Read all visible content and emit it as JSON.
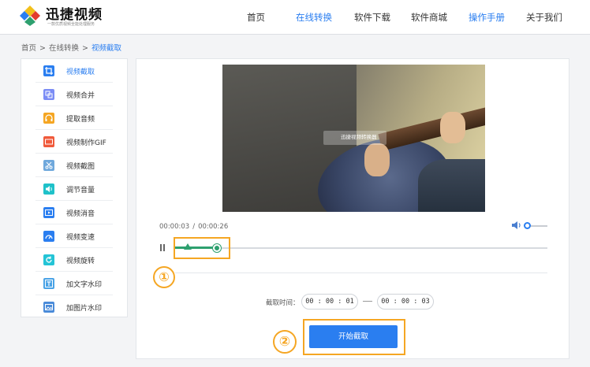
{
  "header": {
    "logo_title": "迅捷视频",
    "logo_subtitle": "一款优质视频全能处理服务",
    "nav": [
      {
        "label": "首页",
        "active": false
      },
      {
        "label": "在线转换",
        "active": true
      },
      {
        "label": "软件下载",
        "active": false
      },
      {
        "label": "软件商城",
        "active": false
      },
      {
        "label": "操作手册",
        "active": true
      },
      {
        "label": "关于我们",
        "active": false
      }
    ]
  },
  "breadcrumb": {
    "items": [
      "首页",
      "在线转换"
    ],
    "current": "视频截取",
    "separator": ">"
  },
  "sidebar": {
    "items": [
      {
        "label": "视频截取",
        "icon": "crop-icon",
        "color": "#2a7ef0",
        "active": true
      },
      {
        "label": "视频合并",
        "icon": "merge-icon",
        "color": "#7b8cf5"
      },
      {
        "label": "提取音频",
        "icon": "headphone-icon",
        "color": "#f5a623"
      },
      {
        "label": "视频制作GIF",
        "icon": "gif-icon",
        "color": "#f05a3b"
      },
      {
        "label": "视频截图",
        "icon": "scissors-icon",
        "color": "#6fa8dc"
      },
      {
        "label": "调节音量",
        "icon": "volume-icon",
        "color": "#1fc1c9"
      },
      {
        "label": "视频消音",
        "icon": "mute-icon",
        "color": "#2a7ef0"
      },
      {
        "label": "视频变速",
        "icon": "speed-icon",
        "color": "#2a7ef0"
      },
      {
        "label": "视频旋转",
        "icon": "rotate-icon",
        "color": "#24c4d6"
      },
      {
        "label": "加文字水印",
        "icon": "text-watermark-icon",
        "color": "#4aa3e6"
      },
      {
        "label": "加图片水印",
        "icon": "image-watermark-icon",
        "color": "#4a8bd9"
      }
    ]
  },
  "player": {
    "watermark": "迅捷视频转换器",
    "current_time": "00:00:03",
    "total_time": "00:00:26",
    "time_separator": "/",
    "volume": 0.1
  },
  "cut": {
    "label": "截取时间：",
    "start": "00 : 00 : 01",
    "end": "00 : 00 : 03",
    "button": "开始截取"
  },
  "annotations": {
    "step1": "①",
    "step2": "②",
    "highlight_color": "#f5a623"
  },
  "colors": {
    "accent": "#2a7ef0",
    "selection": "#2ea06f"
  }
}
